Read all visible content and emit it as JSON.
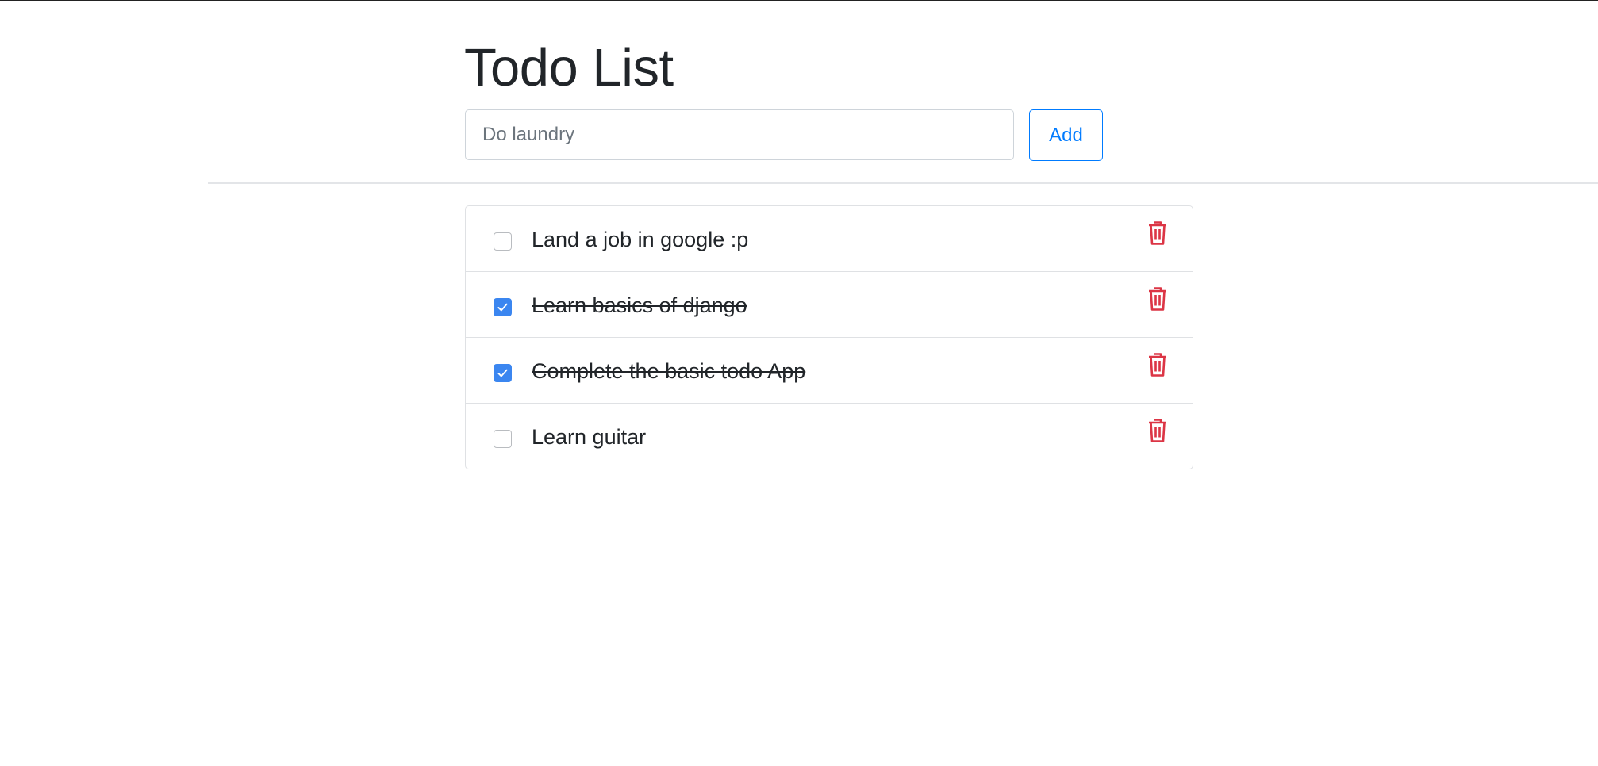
{
  "page": {
    "title": "Todo List"
  },
  "new_todo": {
    "placeholder": "Do laundry",
    "value": "",
    "add_label": "Add"
  },
  "todos": [
    {
      "label": "Land a job in google :p",
      "completed": false
    },
    {
      "label": "Learn basics of django",
      "completed": true
    },
    {
      "label": "Complete the basic todo App",
      "completed": true
    },
    {
      "label": "Learn guitar",
      "completed": false
    }
  ],
  "icons": {
    "delete": "trash-icon",
    "check": "checkmark-icon"
  },
  "colors": {
    "accent": "#007bff",
    "checkbox_checked": "#3b86f0",
    "delete": "#dc3545",
    "text": "#212529"
  }
}
